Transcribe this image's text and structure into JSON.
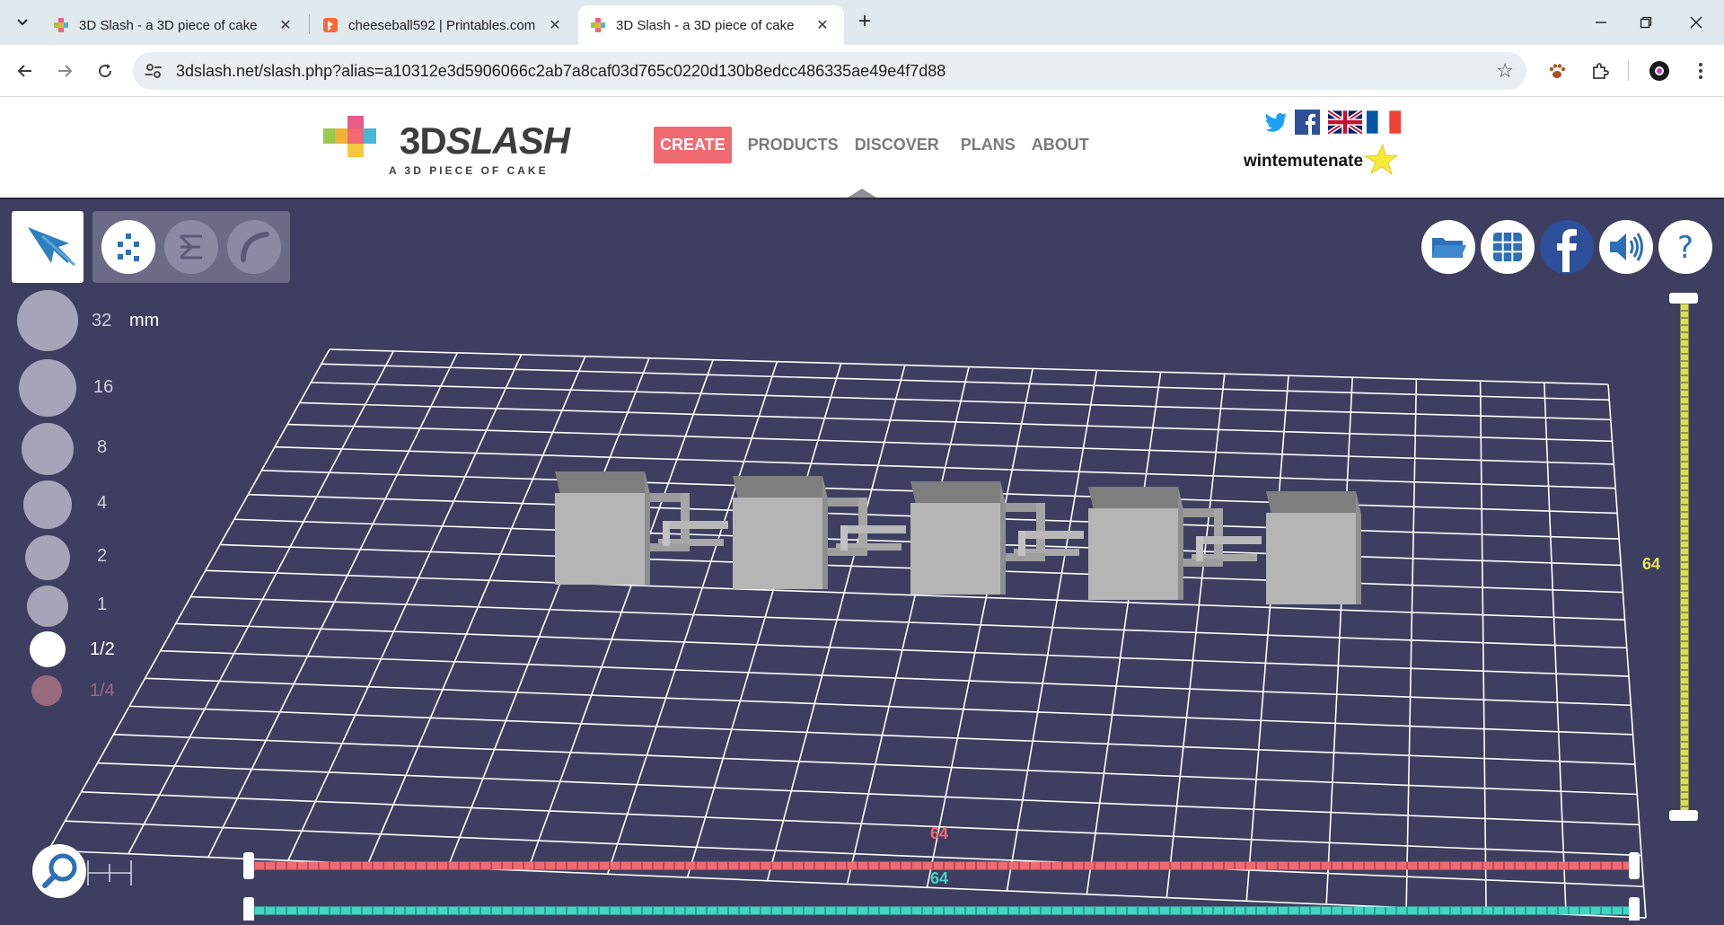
{
  "browser": {
    "tabs": [
      {
        "label": "3D Slash - a 3D piece of cake",
        "active": false
      },
      {
        "label": "cheeseball592 | Printables.com",
        "active": false
      },
      {
        "label": "3D Slash - a 3D piece of cake",
        "active": true
      }
    ],
    "url": "3dslash.net/slash.php?alias=a10312e3d5906066c2ab7a8caf03d765c0220d130b8edcc486335ae49e4f7d88"
  },
  "site": {
    "logo_text_3d": "3D",
    "logo_text_slash": "SLASH",
    "tagline": "A 3D PIECE OF CAKE",
    "nav": [
      "CREATE",
      "PRODUCTS",
      "DISCOVER",
      "PLANS",
      "ABOUT"
    ],
    "username": "wintemutenate"
  },
  "editor": {
    "unit": "mm",
    "sizes": [
      "32",
      "16",
      "8",
      "4",
      "2",
      "1",
      "1/2",
      "1/4"
    ],
    "selected_size": "1/2",
    "vertical_slider_value": "64",
    "red_slider_value": "64",
    "cyan_slider_value": "64",
    "right_buttons": [
      "folder-icon",
      "grid-icon",
      "facebook-icon",
      "sound-icon",
      "help-icon"
    ]
  },
  "colors": {
    "background": "#3e3e60",
    "grid": "#ffffff",
    "red_axis": "#f06a72",
    "cyan_axis": "#3fd6c2",
    "yellow_axis": "#d8e050",
    "model": "#b5b5b5"
  }
}
